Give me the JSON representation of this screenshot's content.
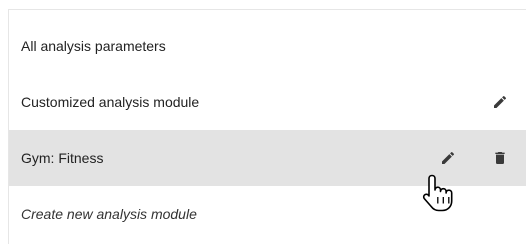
{
  "menu": {
    "items": [
      {
        "label": "All analysis parameters"
      },
      {
        "label": "Customized analysis module"
      },
      {
        "label": "Gym: Fitness"
      },
      {
        "label": "Create new analysis module"
      }
    ]
  },
  "icons": {
    "edit": "pencil-icon",
    "delete": "trash-icon",
    "cursor": "hand-pointer-icon"
  },
  "colors": {
    "active_row_bg": "#e3e3e3",
    "icon": "#3a3a3a"
  }
}
